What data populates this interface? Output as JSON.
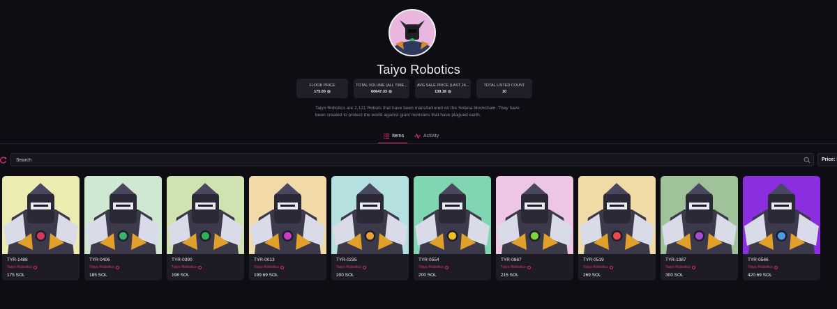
{
  "collection": {
    "name": "Taiyo Robotics",
    "description": "Taiyo Robotics are 2,121 Robots that have been manufactured on the Solana blockchain. They have been created to protect the world against giant monsters that have plagued earth."
  },
  "stats": [
    {
      "label": "FLOOR PRICE",
      "value": "175.00"
    },
    {
      "label": "TOTAL VOLUME (ALL TIME...",
      "value": "60647.33"
    },
    {
      "label": "AVG SALE PRICE (LAST 24...",
      "value": "139.18"
    },
    {
      "label": "TOTAL LISTED COUNT",
      "value": "10"
    }
  ],
  "tabs": {
    "items": "Items",
    "activity": "Activity"
  },
  "search": {
    "placeholder": "Search"
  },
  "sort": {
    "label": "Price: Lo"
  },
  "colors": {
    "accent": "#e52b8e",
    "background": "#0e0d13",
    "card": "#1d1c25"
  },
  "items": [
    {
      "name": "TYR-1486",
      "collection": "Taiyo Robotics",
      "price": "175 SOL",
      "bg": "#ecebb0"
    },
    {
      "name": "TYR-0406",
      "collection": "Taiyo Robotics",
      "price": "185 SOL",
      "bg": "#cfe8d2"
    },
    {
      "name": "TYR-0390",
      "collection": "Taiyo Robotics",
      "price": "198 SOL",
      "bg": "#cfe3b0"
    },
    {
      "name": "TYR-0013",
      "collection": "Taiyo Robotics",
      "price": "199.69 SOL",
      "bg": "#f1d9a8"
    },
    {
      "name": "TYR-0235",
      "collection": "Taiyo Robotics",
      "price": "200 SOL",
      "bg": "#b4e0e0"
    },
    {
      "name": "TYR-0554",
      "collection": "Taiyo Robotics",
      "price": "200 SOL",
      "bg": "#7fd6b0"
    },
    {
      "name": "TYR-0867",
      "collection": "Taiyo Robotics",
      "price": "215 SOL",
      "bg": "#ecc6e3"
    },
    {
      "name": "TYR-0519",
      "collection": "Taiyo Robotics",
      "price": "269 SOL",
      "bg": "#f0dba6"
    },
    {
      "name": "TYR-1387",
      "collection": "Taiyo Robotics",
      "price": "300 SOL",
      "bg": "#9fc29a"
    },
    {
      "name": "TYR-0566",
      "collection": "Taiyo Robotics",
      "price": "420.69 SOL",
      "bg": "#8a2ee0"
    }
  ]
}
